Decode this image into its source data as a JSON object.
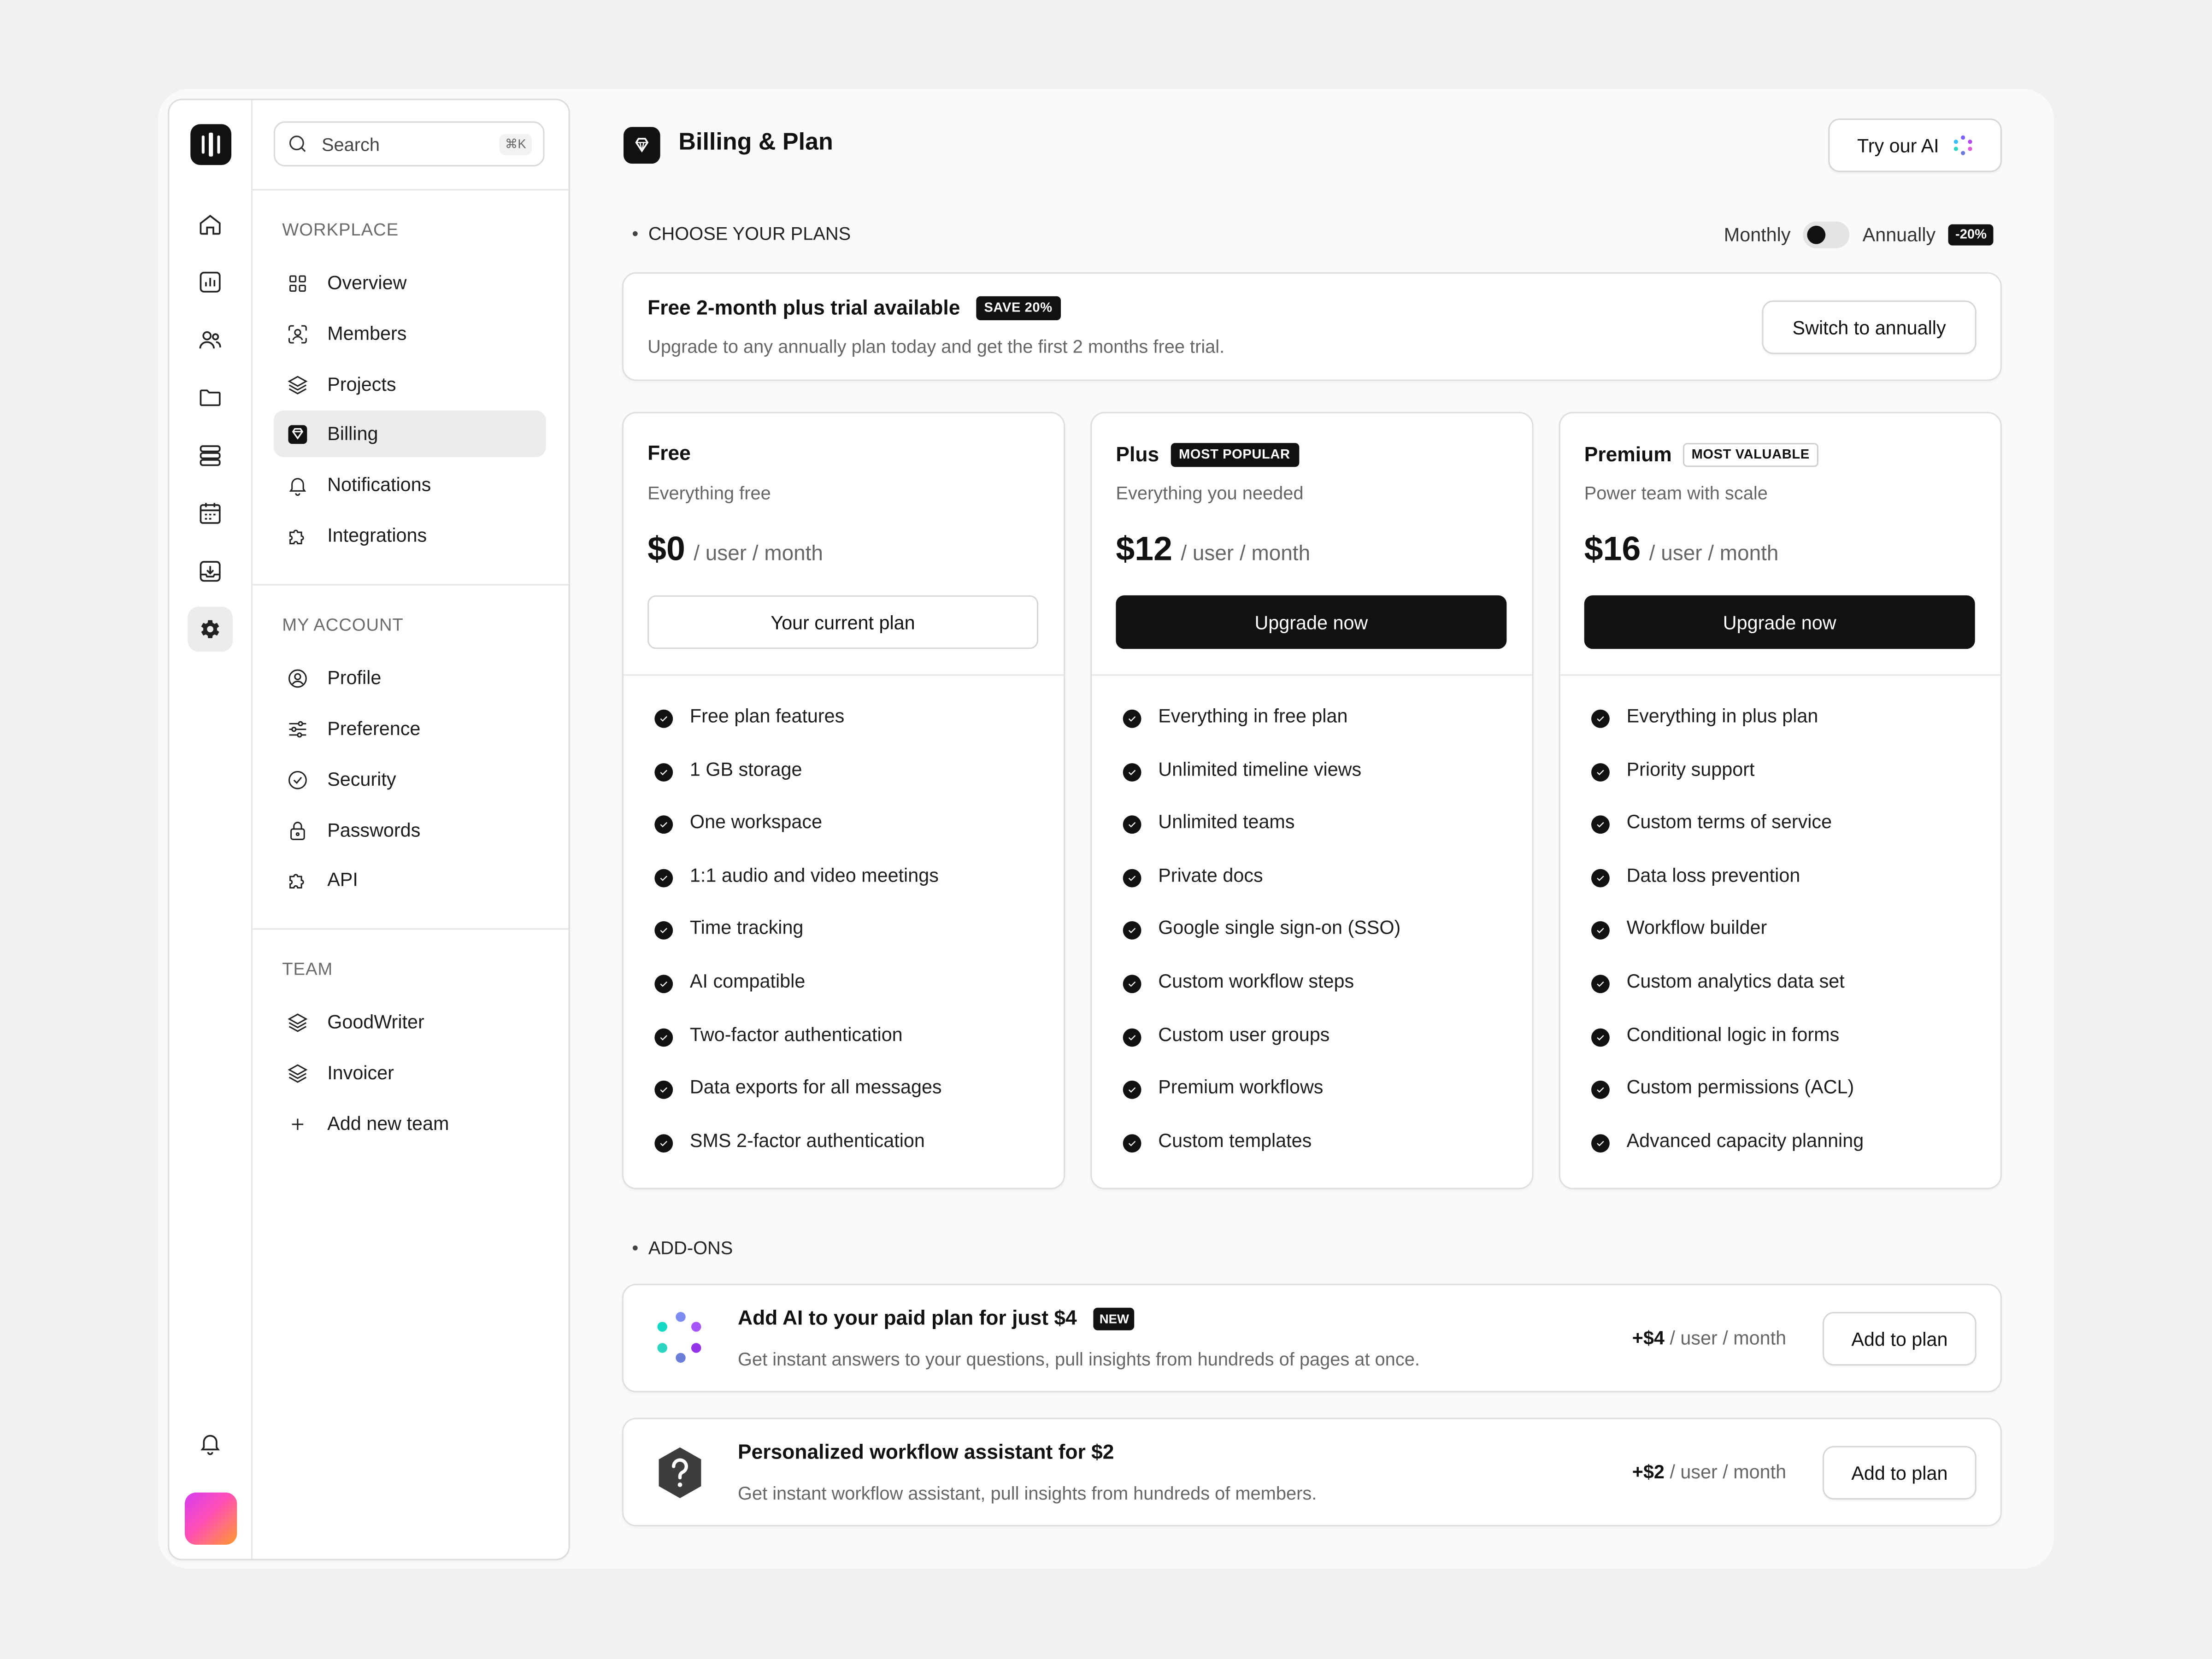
{
  "sidebar": {
    "search": {
      "placeholder": "Search",
      "shortcut": "⌘K"
    },
    "sections": {
      "workplace": "WORKPLACE",
      "account": "MY ACCOUNT",
      "team": "TEAM"
    },
    "workplace_items": [
      "Overview",
      "Members",
      "Projects",
      "Billing",
      "Notifications",
      "Integrations"
    ],
    "account_items": [
      "Profile",
      "Preference",
      "Security",
      "Passwords",
      "API"
    ],
    "team_items": [
      "GoodWriter",
      "Invoicer",
      "Add new team"
    ],
    "active_item": "Billing"
  },
  "header": {
    "title": "Billing & Plan",
    "ai_button": "Try our AI"
  },
  "plans_section": {
    "label": "CHOOSE YOUR PLANS",
    "monthly": "Monthly",
    "annually": "Annually",
    "discount": "-20%"
  },
  "trial": {
    "title": "Free 2-month plus trial available",
    "badge": "SAVE 20%",
    "subtitle": "Upgrade to any annually plan today and get the first 2 months free trial.",
    "button": "Switch to annually"
  },
  "plans": [
    {
      "name": "Free",
      "tag": "",
      "desc": "Everything free",
      "price": "$0",
      "unit": "/ user / month",
      "button": "Your current plan",
      "features": [
        "Free plan features",
        "1 GB storage",
        "One workspace",
        "1:1 audio and video meetings",
        "Time tracking",
        "AI compatible",
        "Two-factor authentication",
        "Data exports for all messages",
        "SMS 2-factor authentication"
      ]
    },
    {
      "name": "Plus",
      "tag": "MOST POPULAR",
      "desc": "Everything you needed",
      "price": "$12",
      "unit": "/ user / month",
      "button": "Upgrade now",
      "features": [
        "Everything in free plan",
        "Unlimited timeline views",
        "Unlimited teams",
        "Private docs",
        "Google single sign-on (SSO)",
        "Custom workflow steps",
        "Custom user groups",
        "Premium workflows",
        "Custom templates"
      ]
    },
    {
      "name": "Premium",
      "tag": "MOST VALUABLE",
      "desc": "Power team with scale",
      "price": "$16",
      "unit": "/ user / month",
      "button": "Upgrade now",
      "features": [
        "Everything in plus plan",
        "Priority support",
        "Custom terms of service",
        "Data loss prevention",
        "Workflow builder",
        "Custom analytics data set",
        "Conditional logic in forms",
        "Custom permissions (ACL)",
        "Advanced capacity planning"
      ]
    }
  ],
  "addons_section": {
    "label": "ADD-ONS"
  },
  "addons": [
    {
      "title": "Add AI to your paid plan for just $4",
      "badge": "NEW",
      "subtitle": "Get instant answers to your questions, pull insights from hundreds of pages at once.",
      "price": "+$4",
      "unit": "/ user / month",
      "button": "Add to plan"
    },
    {
      "title": "Personalized workflow assistant for $2",
      "badge": "",
      "subtitle": "Get instant workflow assistant, pull insights from hundreds of members.",
      "price": "+$2",
      "unit": "/ user / month",
      "button": "Add to plan"
    }
  ],
  "colors": {
    "primary": "#111111",
    "background": "#f1f1f1",
    "frame": "#fafafa",
    "muted_text": "#666666"
  }
}
